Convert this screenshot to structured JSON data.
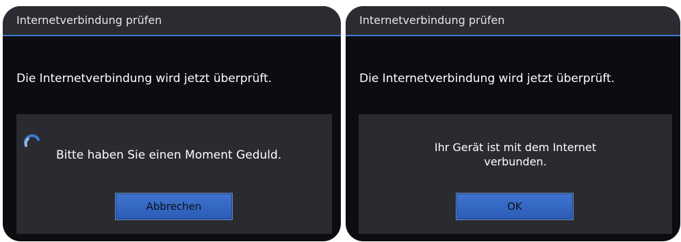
{
  "dialogs": [
    {
      "title": "Internetverbindung prüfen",
      "message": "Die Internetverbindung wird jetzt überprüft.",
      "status": "Bitte haben Sie einen Moment Geduld.",
      "button_label": "Abbrechen",
      "icon": "loading-spinner-icon"
    },
    {
      "title": "Internetverbindung prüfen",
      "message": "Die Internetverbindung wird jetzt überprüft.",
      "status_line1": "Ihr Gerät ist mit dem Internet",
      "status_line2": "verbunden.",
      "button_label": "OK"
    }
  ],
  "colors": {
    "dialog_bg": "#0c0d11",
    "titlebar_bg": "#2b2c31",
    "accent": "#3d7bd1",
    "panel_bg": "#2a2b30",
    "button_bg": "#3668c2"
  }
}
